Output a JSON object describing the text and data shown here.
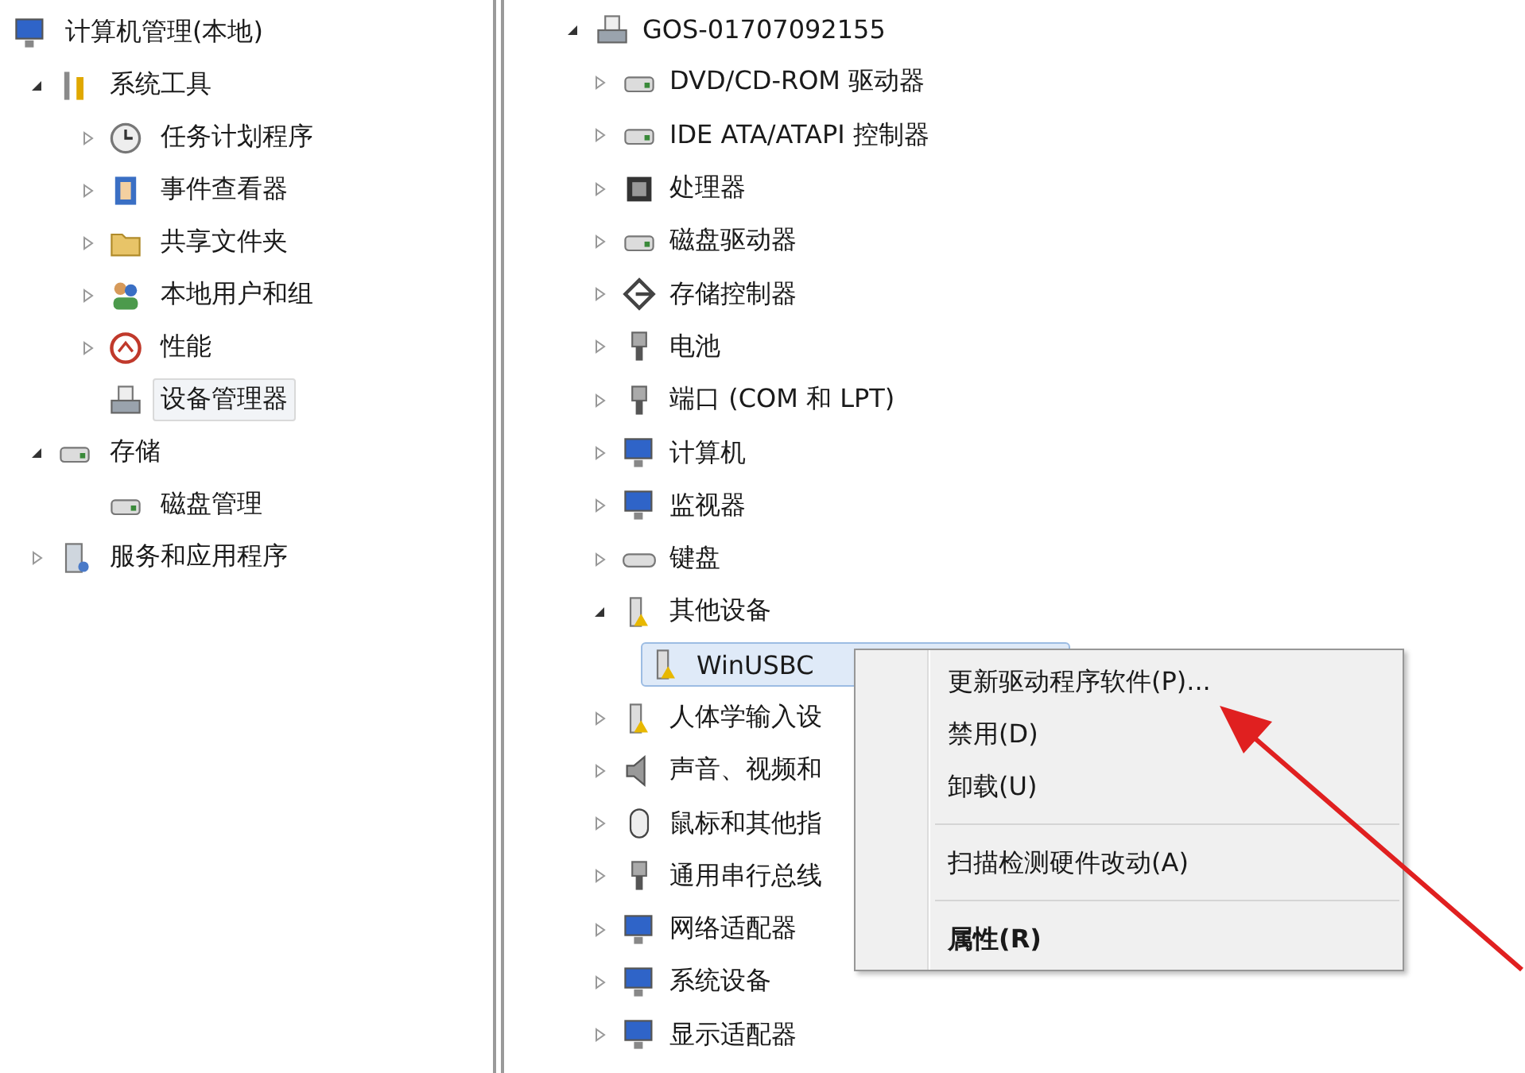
{
  "console_tree": {
    "root": {
      "label": "计算机管理(本地)",
      "selected": false,
      "children": [
        {
          "label": "系统工具",
          "expanded": true,
          "selected": false,
          "children": [
            {
              "label": "任务计划程序",
              "expanded": false,
              "selected": false
            },
            {
              "label": "事件查看器",
              "expanded": false,
              "selected": false
            },
            {
              "label": "共享文件夹",
              "expanded": false,
              "selected": false
            },
            {
              "label": "本地用户和组",
              "expanded": false,
              "selected": false
            },
            {
              "label": "性能",
              "expanded": false,
              "selected": false
            },
            {
              "label": "设备管理器",
              "selected": true
            }
          ]
        },
        {
          "label": "存储",
          "expanded": true,
          "selected": false,
          "children": [
            {
              "label": "磁盘管理",
              "selected": false
            }
          ]
        },
        {
          "label": "服务和应用程序",
          "expanded": false,
          "selected": false
        }
      ]
    }
  },
  "device_tree": {
    "root": {
      "label": "GOS-01707092155",
      "expanded": true,
      "selected": false,
      "children": [
        {
          "label": "DVD/CD-ROM 驱动器",
          "expanded": false,
          "selected": false
        },
        {
          "label": "IDE ATA/ATAPI 控制器",
          "expanded": false,
          "selected": false
        },
        {
          "label": "处理器",
          "expanded": false,
          "selected": false
        },
        {
          "label": "磁盘驱动器",
          "expanded": false,
          "selected": false
        },
        {
          "label": "存储控制器",
          "expanded": false,
          "selected": false
        },
        {
          "label": "电池",
          "expanded": false,
          "selected": false
        },
        {
          "label": "端口 (COM 和 LPT)",
          "expanded": false,
          "selected": false
        },
        {
          "label": "计算机",
          "expanded": false,
          "selected": false
        },
        {
          "label": "监视器",
          "expanded": false,
          "selected": false
        },
        {
          "label": "键盘",
          "expanded": false,
          "selected": false
        },
        {
          "label": "其他设备",
          "expanded": true,
          "selected": false,
          "children": [
            {
              "label": "WinUSBC",
              "selected": true
            }
          ]
        },
        {
          "label": "人体学输入设",
          "expanded": false,
          "selected": false
        },
        {
          "label": "声音、视频和",
          "expanded": false,
          "selected": false
        },
        {
          "label": "鼠标和其他指",
          "expanded": false,
          "selected": false
        },
        {
          "label": "通用串行总线",
          "expanded": false,
          "selected": false
        },
        {
          "label": "网络适配器",
          "expanded": false,
          "selected": false
        },
        {
          "label": "系统设备",
          "expanded": false,
          "selected": false
        },
        {
          "label": "显示适配器",
          "expanded": false,
          "selected": false
        }
      ]
    }
  },
  "context_menu": {
    "items": [
      {
        "kind": "item",
        "label": "更新驱动程序软件(P)...",
        "default": false
      },
      {
        "kind": "item",
        "label": "禁用(D)",
        "default": false
      },
      {
        "kind": "item",
        "label": "卸载(U)",
        "default": false
      },
      {
        "kind": "separator"
      },
      {
        "kind": "item",
        "label": "扫描检测硬件改动(A)",
        "default": false
      },
      {
        "kind": "separator"
      },
      {
        "kind": "item",
        "label": "属性(R)",
        "default": true
      }
    ]
  }
}
